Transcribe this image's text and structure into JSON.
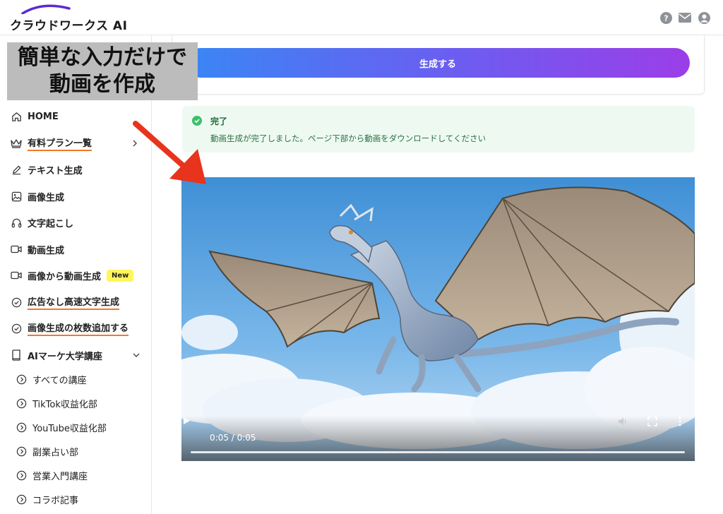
{
  "header": {
    "logo_text": "クラウドワークス AI",
    "icons": [
      "help-icon",
      "mail-icon",
      "user-icon"
    ]
  },
  "overlay": {
    "line1": "簡単な入力だけで",
    "line2": "動画を作成"
  },
  "top_card": {
    "generate_label": "生成する"
  },
  "alert": {
    "title": "完了",
    "message": "動画生成が完了しました。ページ下部から動画をダウンロードしてください"
  },
  "sidebar": {
    "items": [
      {
        "label": "HOME",
        "icon": "home-icon"
      },
      {
        "label": "有料プラン一覧",
        "icon": "crown-icon"
      },
      {
        "label": "テキスト生成",
        "icon": "pen-icon"
      },
      {
        "label": "画像生成",
        "icon": "image-icon"
      },
      {
        "label": "文字起こし",
        "icon": "headphones-icon"
      },
      {
        "label": "動画生成",
        "icon": "video-icon"
      },
      {
        "label": "画像から動画生成",
        "icon": "video-icon",
        "badge": "New"
      },
      {
        "label": "広告なし高速文字生成",
        "icon": "check-circle-icon"
      },
      {
        "label": "画像生成の枚数追加する",
        "icon": "check-circle-icon"
      },
      {
        "label": "AIマーケ大学講座",
        "icon": "book-icon"
      }
    ],
    "subitems": [
      {
        "label": "すべての講座"
      },
      {
        "label": "TikTok収益化部"
      },
      {
        "label": "YouTube収益化部"
      },
      {
        "label": "副業占い部"
      },
      {
        "label": "営業入門講座"
      },
      {
        "label": "コラボ記事"
      }
    ]
  },
  "video": {
    "time": "0:05 / 0:05",
    "progress": 1.0
  },
  "colors": {
    "accent_orange": "#f07a2a",
    "button_start": "#3a86f5",
    "button_end": "#9b3ee8",
    "success": "#3cbf6b",
    "arrow_red": "#e8341c"
  }
}
